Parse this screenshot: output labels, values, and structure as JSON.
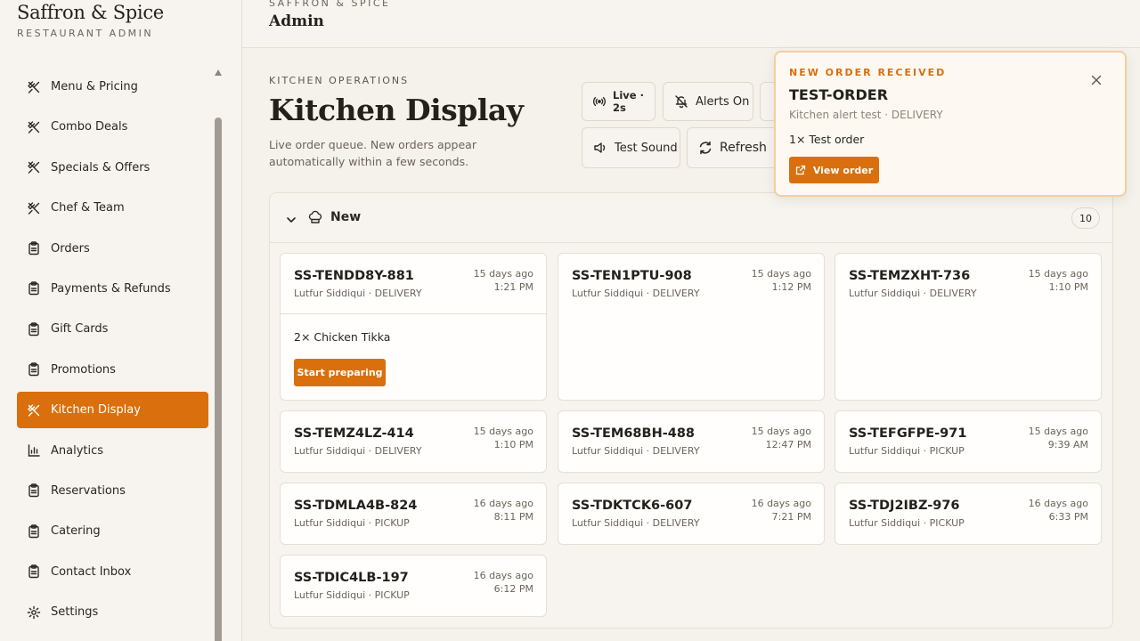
{
  "brand": {
    "title": "Saffron & Spice",
    "subtitle": "RESTAURANT ADMIN"
  },
  "sidebar": {
    "items": [
      {
        "label": "Menu & Pricing",
        "icon": "utensils-icon"
      },
      {
        "label": "Combo Deals",
        "icon": "utensils-icon"
      },
      {
        "label": "Specials & Offers",
        "icon": "utensils-icon"
      },
      {
        "label": "Chef & Team",
        "icon": "utensils-icon"
      },
      {
        "label": "Orders",
        "icon": "clipboard-icon"
      },
      {
        "label": "Payments & Refunds",
        "icon": "clipboard-icon"
      },
      {
        "label": "Gift Cards",
        "icon": "clipboard-icon"
      },
      {
        "label": "Promotions",
        "icon": "clipboard-icon"
      },
      {
        "label": "Kitchen Display",
        "icon": "utensils-icon",
        "active": true
      },
      {
        "label": "Analytics",
        "icon": "bar-chart-icon"
      },
      {
        "label": "Reservations",
        "icon": "clipboard-icon"
      },
      {
        "label": "Catering",
        "icon": "clipboard-icon"
      },
      {
        "label": "Contact Inbox",
        "icon": "clipboard-icon"
      },
      {
        "label": "Settings",
        "icon": "gear-icon"
      }
    ]
  },
  "header": {
    "subtitle": "SAFFRON & SPICE",
    "title": "Admin"
  },
  "page": {
    "eyebrow": "KITCHEN OPERATIONS",
    "title": "Kitchen Display",
    "description": "Live order queue. New orders appear automatically within a few seconds."
  },
  "toolbar": {
    "live_label": "Live · 2s",
    "alerts_label": "Alerts On",
    "test_sound_label": "Test Sound",
    "refresh_label": "Refresh"
  },
  "section": {
    "label": "New",
    "count": "10"
  },
  "orders": [
    {
      "id": "SS-TENDD8Y-881",
      "customer": "Lutfur Siddiqui · DELIVERY",
      "ago": "15 days ago",
      "time": "1:21 PM",
      "item": "2× Chicken Tikka",
      "action": "Start preparing"
    },
    {
      "id": "SS-TEN1PTU-908",
      "customer": "Lutfur Siddiqui · DELIVERY",
      "ago": "15 days ago",
      "time": "1:12 PM"
    },
    {
      "id": "SS-TEMZXHT-736",
      "customer": "Lutfur Siddiqui · DELIVERY",
      "ago": "15 days ago",
      "time": "1:10 PM"
    },
    {
      "id": "SS-TEMZ4LZ-414",
      "customer": "Lutfur Siddiqui · DELIVERY",
      "ago": "15 days ago",
      "time": "1:10 PM"
    },
    {
      "id": "SS-TEM68BH-488",
      "customer": "Lutfur Siddiqui · DELIVERY",
      "ago": "15 days ago",
      "time": "12:47 PM"
    },
    {
      "id": "SS-TEFGFPE-971",
      "customer": "Lutfur Siddiqui · PICKUP",
      "ago": "15 days ago",
      "time": "9:39 AM"
    },
    {
      "id": "SS-TDMLA4B-824",
      "customer": "Lutfur Siddiqui · PICKUP",
      "ago": "16 days ago",
      "time": "8:11 PM"
    },
    {
      "id": "SS-TDKTCK6-607",
      "customer": "Lutfur Siddiqui · DELIVERY",
      "ago": "16 days ago",
      "time": "7:21 PM"
    },
    {
      "id": "SS-TDJ2IBZ-976",
      "customer": "Lutfur Siddiqui · PICKUP",
      "ago": "16 days ago",
      "time": "6:33 PM"
    },
    {
      "id": "SS-TDIC4LB-197",
      "customer": "Lutfur Siddiqui · PICKUP",
      "ago": "16 days ago",
      "time": "6:12 PM"
    }
  ],
  "toast": {
    "eyebrow": "NEW ORDER RECEIVED",
    "title": "TEST-ORDER",
    "subtitle": "Kitchen alert test · DELIVERY",
    "item": "1× Test order",
    "button_label": "View order"
  },
  "colors": {
    "accent": "#d9700d",
    "background": "#f5f1eb",
    "card": "#fffefc",
    "border": "#e6dfd4"
  }
}
